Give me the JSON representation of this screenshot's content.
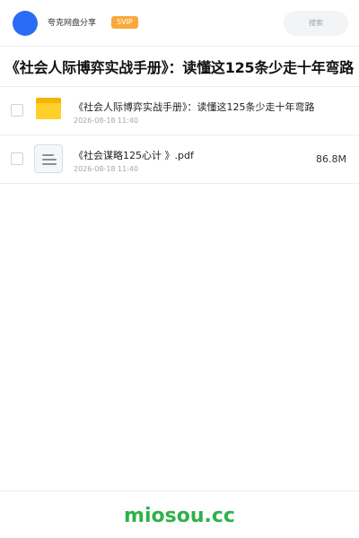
{
  "header": {
    "brand": "夸克网盘分享",
    "badge": "SVIP",
    "search_placeholder": "搜索"
  },
  "share": {
    "title": "《社会人际博弈实战手册》：读懂这125条少走十年弯路"
  },
  "files": [
    {
      "name": "《社会人际博弈实战手册》：读懂这125条少走十年弯路",
      "time": "2026-08-18 11:40",
      "size": "",
      "icon": "folder-icon"
    },
    {
      "name": "《社会谋略125心计 》.pdf",
      "time": "2026-08-18 11:40",
      "size": "86.8M",
      "icon": "document-icon"
    }
  ],
  "footer": {
    "brand": "miosou.cc"
  },
  "colors": {
    "avatar": "#2a6df4",
    "svip": "#f7a93b",
    "folder": "#ffd02a",
    "footer_brand": "#2fb14a"
  }
}
